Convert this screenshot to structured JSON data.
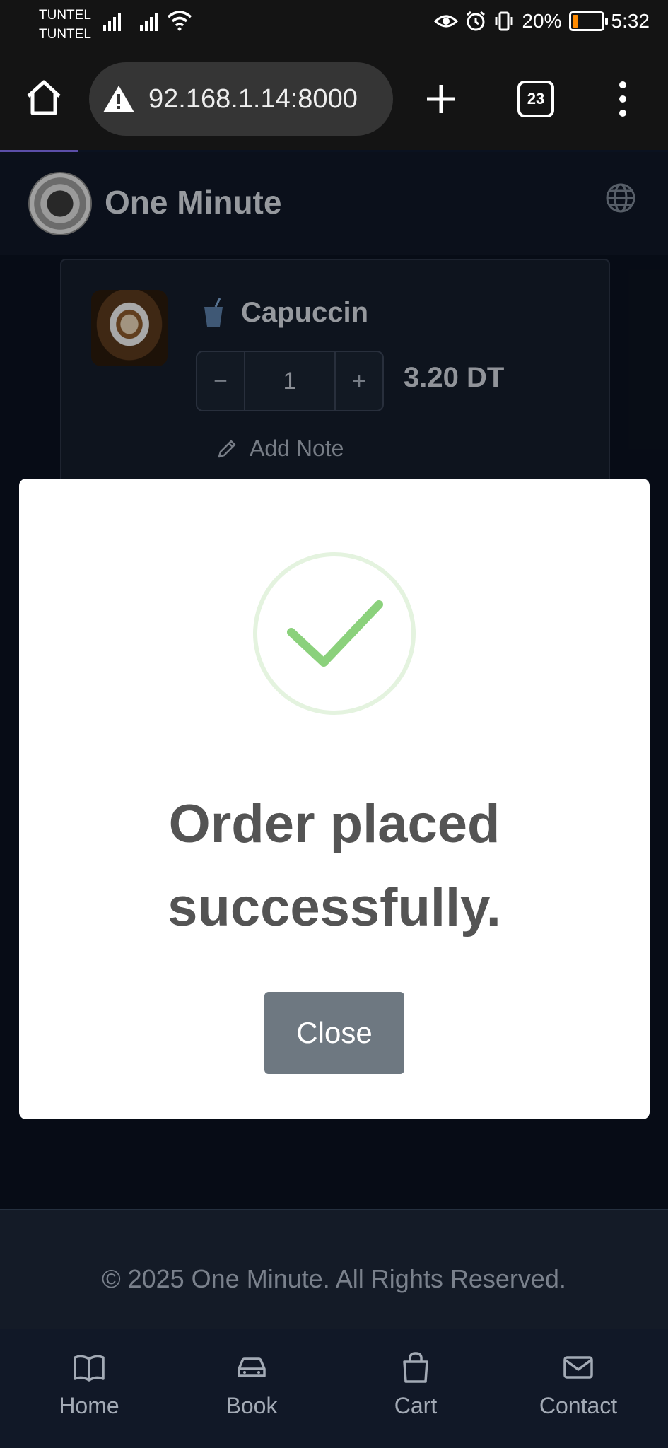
{
  "status_bar": {
    "carrier1": "TUNTEL",
    "carrier2": "TUNTEL",
    "battery_percent_text": "20%",
    "battery_level": 0.2,
    "time": "5:32",
    "icons": [
      "signal-icon",
      "wifi-icon",
      "eye-icon",
      "alarm-icon",
      "vibrate-icon",
      "battery-icon"
    ]
  },
  "browser": {
    "url": "92.168.1.14:8000",
    "tab_count": "23"
  },
  "site": {
    "name": "One Minute"
  },
  "cart_item": {
    "name": "Capuccin",
    "quantity": "1",
    "decrement_label": "−",
    "increment_label": "+",
    "price": "3.20 DT",
    "note_label": "Add Note"
  },
  "modal": {
    "message": "Order placed successfully.",
    "close_label": "Close",
    "success_color": "#8bd17c"
  },
  "footer": {
    "copyright": "© 2025 One Minute. All Rights Reserved."
  },
  "bottom_nav": {
    "items": [
      {
        "label": "Home",
        "icon": "book-open-icon"
      },
      {
        "label": "Book",
        "icon": "car-icon"
      },
      {
        "label": "Cart",
        "icon": "shopping-bag-icon"
      },
      {
        "label": "Contact",
        "icon": "mail-icon"
      }
    ]
  }
}
